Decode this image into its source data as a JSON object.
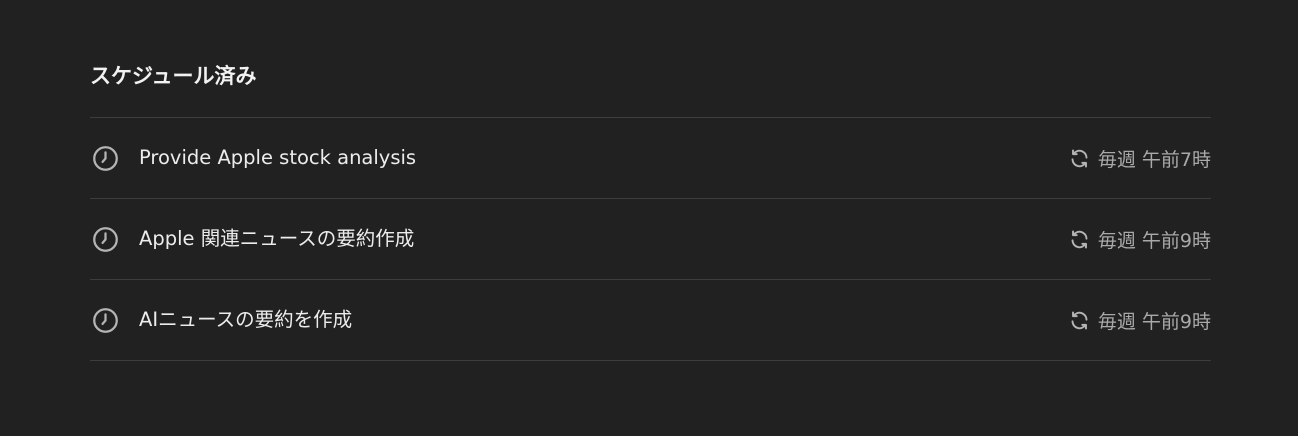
{
  "section": {
    "title": "スケジュール済み"
  },
  "tasks": [
    {
      "title": "Provide Apple stock analysis",
      "schedule": "毎週 午前7時",
      "icon": "clock-icon",
      "schedule_icon": "repeat-icon"
    },
    {
      "title": "Apple 関連ニュースの要約作成",
      "schedule": "毎週 午前9時",
      "icon": "clock-icon",
      "schedule_icon": "repeat-icon"
    },
    {
      "title": "AIニュースの要約を作成",
      "schedule": "毎週 午前9時",
      "icon": "clock-icon",
      "schedule_icon": "repeat-icon"
    }
  ],
  "colors": {
    "background": "#212121",
    "divider": "#3d3d3d",
    "primary_text": "#ececec",
    "secondary_text": "#a9a9a9"
  }
}
